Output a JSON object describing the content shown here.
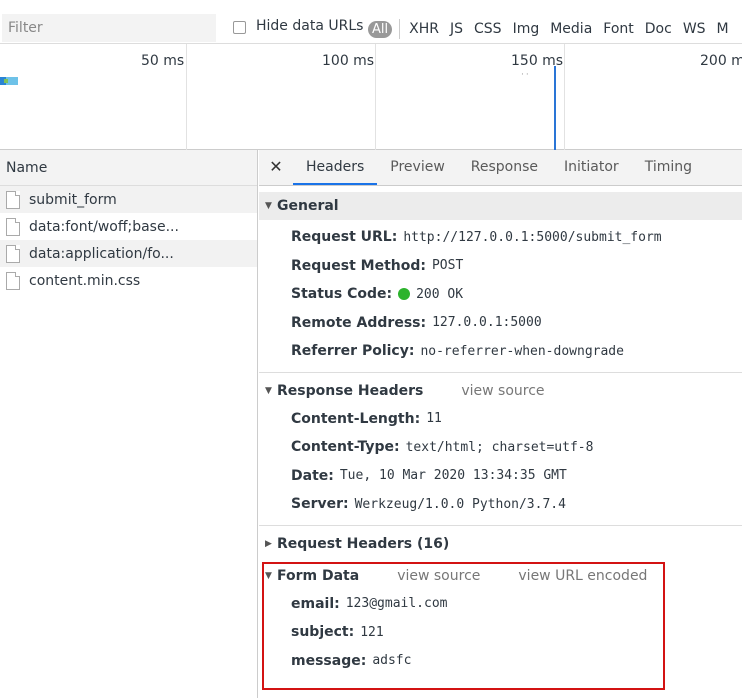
{
  "filterbar": {
    "filter_placeholder": "Filter",
    "hide_data_urls_label": "Hide data URLs",
    "type_filters": [
      "All",
      "XHR",
      "JS",
      "CSS",
      "Img",
      "Media",
      "Font",
      "Doc",
      "WS",
      "M"
    ]
  },
  "overview": {
    "ticks": [
      "50 ms",
      "100 ms",
      "150 ms",
      "200 m"
    ]
  },
  "request_list": {
    "header": "Name",
    "rows": [
      "submit_form",
      "data:font/woff;base...",
      "data:application/fo...",
      "content.min.css"
    ]
  },
  "details": {
    "tabs": [
      "Headers",
      "Preview",
      "Response",
      "Initiator",
      "Timing"
    ],
    "general": {
      "title": "General",
      "rows": [
        {
          "key": "Request URL:",
          "value": "http://127.0.0.1:5000/submit_form"
        },
        {
          "key": "Request Method:",
          "value": "POST"
        },
        {
          "key": "Status Code:",
          "value": "200 OK"
        },
        {
          "key": "Remote Address:",
          "value": "127.0.0.1:5000"
        },
        {
          "key": "Referrer Policy:",
          "value": "no-referrer-when-downgrade"
        }
      ]
    },
    "response_headers": {
      "title": "Response Headers",
      "view_source": "view source",
      "rows": [
        {
          "key": "Content-Length:",
          "value": "11"
        },
        {
          "key": "Content-Type:",
          "value": "text/html; charset=utf-8"
        },
        {
          "key": "Date:",
          "value": "Tue, 10 Mar 2020 13:34:35 GMT"
        },
        {
          "key": "Server:",
          "value": "Werkzeug/1.0.0 Python/3.7.4"
        }
      ]
    },
    "request_headers": {
      "title": "Request Headers (16)"
    },
    "form_data": {
      "title": "Form Data",
      "view_source": "view source",
      "view_url_encoded": "view URL encoded",
      "rows": [
        {
          "key": "email:",
          "value": "123@gmail.com"
        },
        {
          "key": "subject:",
          "value": "121"
        },
        {
          "key": "message:",
          "value": "adsfc"
        }
      ]
    }
  },
  "colors": {
    "highlight": "#d31313",
    "active_tab": "#1a73e8",
    "status_ok": "#2db32d"
  }
}
